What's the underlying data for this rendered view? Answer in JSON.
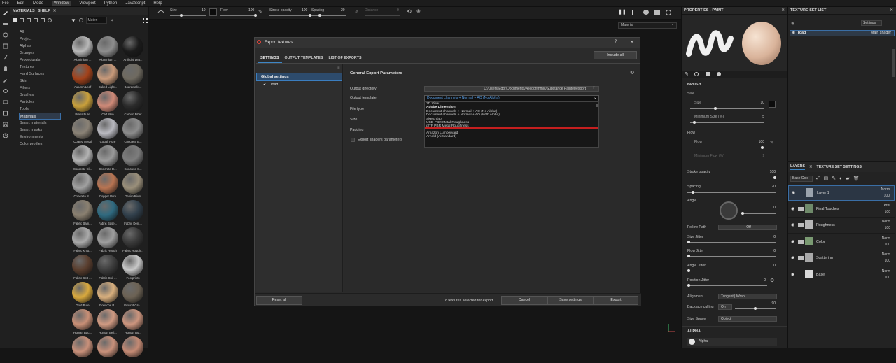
{
  "menu": [
    "File",
    "Edit",
    "Mode",
    "Window",
    "Viewport",
    "Python",
    "JavaScript",
    "Help"
  ],
  "menu_active": "Window",
  "shelf": {
    "tabs": [
      "MATERIALS",
      "SHELF"
    ],
    "search_placeholder": "Materi",
    "categories": [
      "All",
      "Project",
      "Alphas",
      "Grunges",
      "Procedurals",
      "Textures",
      "Hard Surfaces",
      "Skin",
      "Filters",
      "Brushes",
      "Particles",
      "Tools",
      "Materials",
      "Smart materials",
      "Smart masks",
      "Environments",
      "Color profiles"
    ],
    "selected_category": "Materials",
    "materials": [
      {
        "name": "Aluminium ...",
        "color": "#b8b8b8"
      },
      {
        "name": "Aluminium ...",
        "color": "#8e8e8e"
      },
      {
        "name": "Artificial Lea...",
        "color": "#1b1b1b"
      },
      {
        "name": "Autumn Leaf",
        "color": "#a3421b"
      },
      {
        "name": "Baked Light...",
        "color": "#c99a7a"
      },
      {
        "name": "Boardwalk ...",
        "color": "#6f6a60"
      },
      {
        "name": "Brass Pure",
        "color": "#c9a03b"
      },
      {
        "name": "Calf Skin",
        "color": "#d08a78"
      },
      {
        "name": "Carbon Fiber",
        "color": "#2b2b2b"
      },
      {
        "name": "Coated Metal",
        "color": "#8a8276"
      },
      {
        "name": "Cobalt Pure",
        "color": "#b9b9c0"
      },
      {
        "name": "Concrete B...",
        "color": "#8c8c8c"
      },
      {
        "name": "Concrete Cl...",
        "color": "#b3b3b3"
      },
      {
        "name": "Concrete D...",
        "color": "#9a9a9a"
      },
      {
        "name": "Concrete S...",
        "color": "#7d7d7d"
      },
      {
        "name": "Concrete S...",
        "color": "#a1a1a1"
      },
      {
        "name": "Copper Pure",
        "color": "#b87452"
      },
      {
        "name": "Denim Rivet",
        "color": "#9a8f7a"
      },
      {
        "name": "Fabric Bam...",
        "color": "#8a8070"
      },
      {
        "name": "Fabric Base...",
        "color": "#2f6a80"
      },
      {
        "name": "Fabric Deni...",
        "color": "#31404c"
      },
      {
        "name": "Fabric Knitt...",
        "color": "#aaaaaa"
      },
      {
        "name": "Fabric Rough",
        "color": "#9e9e9e"
      },
      {
        "name": "Fabric Rough...",
        "color": "#3a3a3a"
      },
      {
        "name": "Fabric Soft ...",
        "color": "#5a3e2e"
      },
      {
        "name": "Fabric Suit ...",
        "color": "#3e3e3e"
      },
      {
        "name": "Footprints",
        "color": "#c8c8c8"
      },
      {
        "name": "Gold Pure",
        "color": "#d9a93e"
      },
      {
        "name": "Gouache P...",
        "color": "#d9b07e"
      },
      {
        "name": "Ground Gra...",
        "color": "#6c6254"
      },
      {
        "name": "Human Bac...",
        "color": "#c88f76"
      },
      {
        "name": "Human Bell...",
        "color": "#d09a82"
      },
      {
        "name": "Human Bu...",
        "color": "#cd957e"
      },
      {
        "name": "",
        "color": "#c8907a"
      },
      {
        "name": "",
        "color": "#c9917b"
      },
      {
        "name": "",
        "color": "#c48a74"
      }
    ]
  },
  "toolbar": {
    "size_label": "Size",
    "size_value": "10",
    "flow_label": "Flow",
    "flow_value": "100",
    "stroke_opacity_label": "Stroke opacity",
    "stroke_opacity_value": "100",
    "spacing_label": "Spacing",
    "spacing_value": "20",
    "distance_label": "Distance",
    "distance_value": "0"
  },
  "viewport": {
    "mode": "Material"
  },
  "dialog": {
    "title": "Export textures",
    "help": "?",
    "tabs": [
      "SETTINGS",
      "OUTPUT TEMPLATES",
      "LIST OF EXPORTS"
    ],
    "include_all": "Include all",
    "global_settings": "Global settings",
    "texture_set": "Toad",
    "section_title": "General Export Parameters",
    "output_directory_label": "Output directory",
    "output_directory_value": "C:/Users/Egor/Documents/Allegorithmic/Substance Painter/export",
    "output_template_label": "Output template",
    "output_template_value": "Document channels + Normal + AO (No Alpha)",
    "file_type_label": "File type",
    "size_label": "Size",
    "padding_label": "Padding",
    "export_shaders_label": "Export shaders parameters",
    "template_options": [
      {
        "text": "3D View",
        "kind": "item"
      },
      {
        "text": "Adobe Dimension",
        "kind": "hdr"
      },
      {
        "text": "Document channels + Normal + AO (No Alpha)",
        "kind": "item"
      },
      {
        "text": "Document channels + Normal + AO (With Alpha)",
        "kind": "item"
      },
      {
        "text": "Sketchfab",
        "kind": "item"
      },
      {
        "text": "USD PBR Metal Roughness",
        "kind": "item"
      },
      {
        "text": "glTF PBR Metal Roughness",
        "kind": "underline"
      },
      {
        "text": "",
        "kind": "gap"
      },
      {
        "text": "Amazon Lumberyard",
        "kind": "item"
      },
      {
        "text": "Arnold (AiStandard)",
        "kind": "item"
      }
    ],
    "reset_all": "Reset all",
    "status": "8 textures selected for export",
    "cancel": "Cancel",
    "save_settings": "Save settings",
    "export": "Export"
  },
  "properties": {
    "title": "PROPERTIES - PAINT",
    "brush_section": "BRUSH",
    "size_label": "Size",
    "size_sub": "Size",
    "size_value": "10",
    "min_size_label": "Minimum Size (%)",
    "min_size_value": "5",
    "flow_label": "Flow",
    "flow_sub": "Flow",
    "flow_value": "100",
    "min_flow_label": "Minimum Flow (%)",
    "min_flow_value": "1",
    "stroke_opacity_label": "Stroke opacity",
    "stroke_opacity_value": "100",
    "spacing_label": "Spacing",
    "spacing_value": "20",
    "angle_label": "Angle",
    "angle_value": "0",
    "follow_path_label": "Follow Path",
    "follow_path_value": "Off",
    "size_jitter_label": "Size Jitter",
    "size_jitter_value": "0",
    "flow_jitter_label": "Flow Jitter",
    "flow_jitter_value": "0",
    "angle_jitter_label": "Angle Jitter",
    "angle_jitter_value": "0",
    "position_jitter_label": "Position Jitter",
    "position_jitter_value": "0",
    "alignment_label": "Alignment",
    "alignment_value": "Tangent | Wrap",
    "backface_label": "Backface culling",
    "backface_value": "On",
    "backface_num": "90",
    "size_space_label": "Size Space",
    "size_space_value": "Object",
    "alpha_section": "ALPHA",
    "alpha_name": "Alpha"
  },
  "texture_set_list": {
    "title": "TEXTURE SET LIST",
    "settings": "Settings",
    "row_name": "Toad",
    "row_shader": "Main shader"
  },
  "layers": {
    "tabs": [
      "LAYERS",
      "TEXTURE SET SETTINGS"
    ],
    "blend": "Base Colc",
    "items": [
      {
        "name": "Layer 1",
        "blend": "Norm",
        "opacity": "100",
        "thumb": "#9aa3ad",
        "folder": false,
        "selected": true
      },
      {
        "name": "Final Touches",
        "blend": "Pthr",
        "opacity": "100",
        "thumb": "#6f8a6a",
        "folder": true,
        "selected": false
      },
      {
        "name": "Roughness",
        "blend": "Norm",
        "opacity": "100",
        "thumb": "#b7b7b7",
        "folder": true,
        "selected": false
      },
      {
        "name": "Color",
        "blend": "Norm",
        "opacity": "100",
        "thumb": "#7a9a72",
        "folder": true,
        "selected": false
      },
      {
        "name": "Scattering",
        "blend": "Norm",
        "opacity": "100",
        "thumb": "#a8a8a8",
        "folder": true,
        "selected": false
      },
      {
        "name": "Base",
        "blend": "Norm",
        "opacity": "100",
        "thumb": "#d9d9d9",
        "folder": false,
        "selected": false
      }
    ]
  },
  "colors": {
    "accent": "#3d86c6",
    "selection": "#2d4b6c",
    "underline": "#c51f1f"
  }
}
